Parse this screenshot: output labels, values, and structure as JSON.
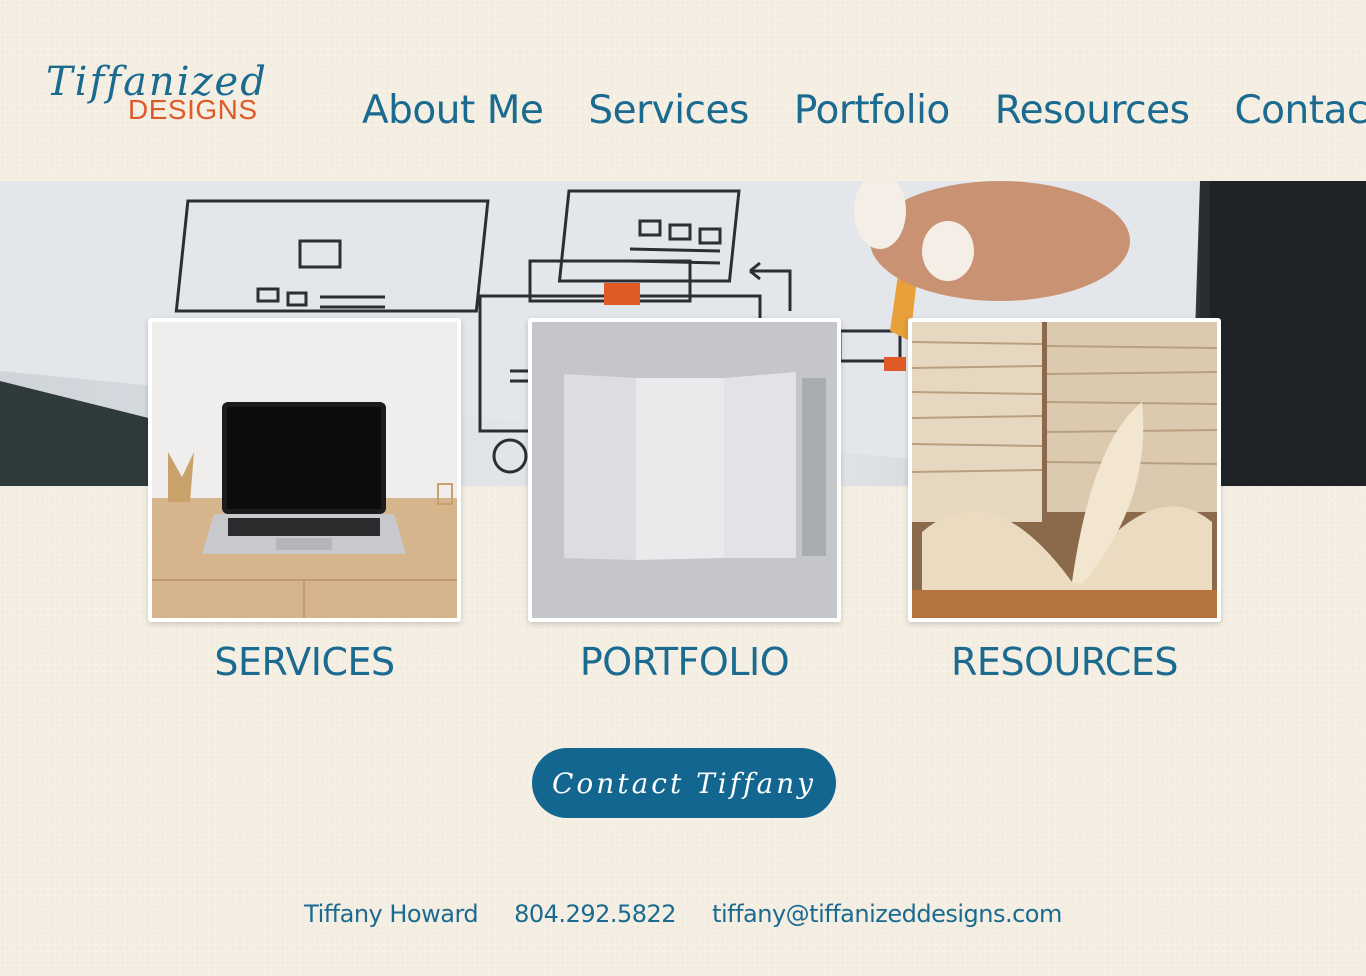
{
  "logo": {
    "script": "Tiffanized",
    "sub": "DESIGNS"
  },
  "nav": {
    "items": [
      {
        "label": "About Me"
      },
      {
        "label": "Services"
      },
      {
        "label": "Portfolio"
      },
      {
        "label": "Resources"
      },
      {
        "label": "Contact"
      }
    ]
  },
  "cards": [
    {
      "label": "SERVICES",
      "image": "laptop-on-desk"
    },
    {
      "label": "PORTFOLIO",
      "image": "trifold-brochure"
    },
    {
      "label": "RESOURCES",
      "image": "stacked-books"
    }
  ],
  "cta": {
    "label": "Contact Tiffany"
  },
  "footer": {
    "name": "Tiffany Howard",
    "phone": "804.292.5822",
    "email": "tiffany@tiffanizeddesigns.com"
  },
  "colors": {
    "brand_blue": "#1b6a90",
    "button_blue": "#12668f",
    "accent_orange": "#dd5a2a",
    "background": "#f5efe3"
  }
}
